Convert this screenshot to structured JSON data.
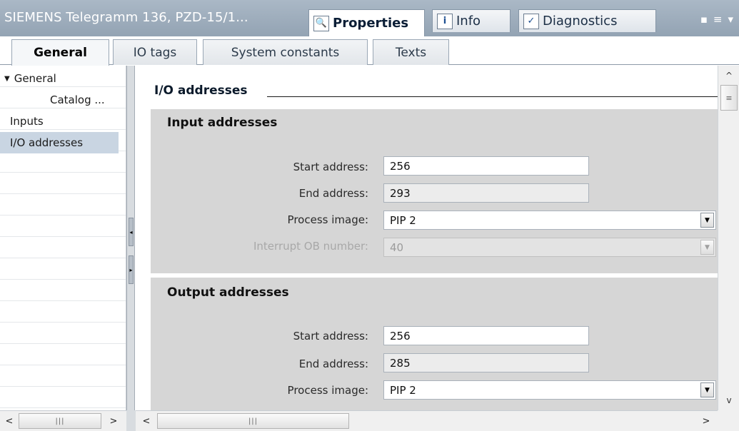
{
  "window": {
    "title": "SIEMENS Telegramm 136, PZD-15/1...",
    "tabs": [
      {
        "label": "Properties",
        "icon": "properties-icon",
        "icon_glyph": "🔍"
      },
      {
        "label": "Info",
        "icon": "info-icon",
        "icon_glyph": "i"
      },
      {
        "label": "Diagnostics",
        "icon": "diagnostics-icon",
        "icon_glyph": "✓"
      }
    ],
    "controls": {
      "restore": "▪",
      "list": "≡",
      "menu": "▾"
    }
  },
  "subtabs": [
    "General",
    "IO tags",
    "System constants",
    "Texts"
  ],
  "nav": {
    "items": [
      {
        "label": "General",
        "expanded_marker": "▼"
      },
      {
        "label": "Catalog ..."
      },
      {
        "label": "Inputs"
      },
      {
        "label": "I/O addresses"
      }
    ]
  },
  "content": {
    "section_title": "I/O addresses",
    "input": {
      "title": "Input addresses",
      "start_label": "Start address:",
      "start_value": "256",
      "end_label": "End address:",
      "end_value": "293",
      "pip_label": "Process image:",
      "pip_value": "PIP 2",
      "ob_label": "Interrupt OB number:",
      "ob_value": "40"
    },
    "output": {
      "title": "Output addresses",
      "start_label": "Start address:",
      "start_value": "256",
      "end_label": "End address:",
      "end_value": "285",
      "pip_label": "Process image:",
      "pip_value": "PIP 2"
    }
  },
  "scroll": {
    "up": "^",
    "down": "v",
    "left": "<",
    "right": ">",
    "grip": "|||",
    "vgrip": "≡"
  }
}
